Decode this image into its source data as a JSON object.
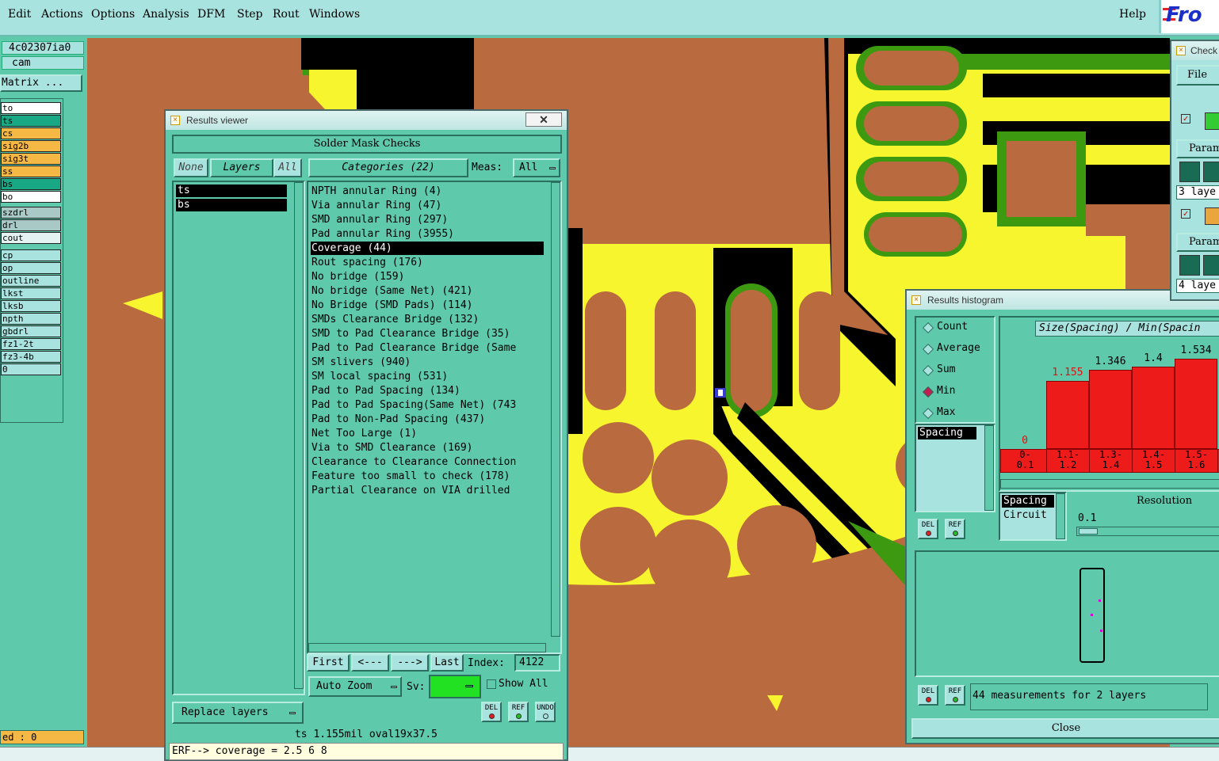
{
  "menubar": {
    "items": [
      "Edit",
      "Actions",
      "Options",
      "Analysis",
      "DFM",
      "Step",
      "Rout",
      "Windows"
    ],
    "help": "Help",
    "logo": "Fro"
  },
  "left_panel": {
    "job": "4c02307ia0",
    "step": "cam",
    "matrix_button": "Matrix ...",
    "layers": [
      "to",
      "ts",
      "cs",
      "sig2b",
      "sig3t",
      "ss",
      "bs",
      "bo",
      "szdrl",
      "drl",
      "cout",
      "cp",
      "op",
      "outline",
      "lkst",
      "lksb",
      "npth",
      "gbdrl",
      "fz1-2t",
      "fz3-4b",
      "0"
    ],
    "status": "ed : 0"
  },
  "results_viewer": {
    "title": "Results viewer",
    "close": "✕",
    "header": "Solder Mask Checks",
    "none_btn": "None",
    "layers_btn": "Layers",
    "all_btn": "All",
    "layers": [
      "ts",
      "bs"
    ],
    "categories_btn": "Categories (22)",
    "meas_label": "Meas:",
    "meas_value": "All",
    "categories": [
      "NPTH annular Ring (4)",
      "Via annular Ring (47)",
      "SMD annular Ring (297)",
      "Pad annular Ring (3955)",
      "Coverage (44)",
      "Rout spacing (176)",
      "No bridge (159)",
      "No bridge (Same Net) (421)",
      "No Bridge (SMD Pads) (114)",
      "SMDs Clearance Bridge (132)",
      "SMD to Pad Clearance Bridge (35)",
      "Pad to Pad Clearance Bridge (Same",
      "SM slivers (940)",
      "SM local spacing (531)",
      "Pad to Pad Spacing (134)",
      "Pad to Pad Spacing(Same Net) (743",
      "Pad to Non-Pad Spacing (437)",
      "Net Too Large (1)",
      "Via to SMD Clearance (169)",
      "Clearance to Clearance Connection",
      "Feature too small to check (178)",
      "Partial Clearance on VIA drilled"
    ],
    "selected_category": "Coverage (44)",
    "first_btn": "First",
    "prev_btn": "<---",
    "next_btn": "--->",
    "last_btn": "Last",
    "index_label": "Index:",
    "index_value": "4122",
    "auto_zoom_btn": "Auto Zoom",
    "sv_label": "Sv:",
    "show_all_label": "Show All",
    "replace_layers_btn": "Replace layers",
    "del_label": "DEL",
    "ref_label": "REF",
    "undo_label": "UNDO",
    "status_line": "ts 1.155mil  oval19x37.5",
    "erf_line": "ERF--> coverage = 2.5 6 8"
  },
  "histogram": {
    "title": "Results histogram",
    "stats": [
      "Count",
      "Average",
      "Sum",
      "Min",
      "Max"
    ],
    "selected_stat": "Min",
    "measure_list": [
      "Spacing"
    ],
    "graph_title": "Size(Spacing) / Min(Spacin",
    "lower_list": [
      "Spacing",
      "Circuit"
    ],
    "resolution_label": "Resolution",
    "resolution_value": "0.1",
    "del_label": "DEL",
    "ref_label": "REF",
    "measurements": "44 measurements for 2 layers",
    "close": "Close"
  },
  "chart_data": {
    "type": "bar",
    "categories": [
      "0-0.1",
      "1.1-1.2",
      "1.3-1.4",
      "1.4-1.5",
      "1.5-1.6"
    ],
    "values": [
      0,
      1.155,
      1.346,
      1.4,
      1.534
    ],
    "value_labels": [
      "0",
      "1.155",
      "1.346",
      "1.4",
      "1.534"
    ],
    "bin_labels_top": [
      "0-",
      "1.1-",
      "1.3-",
      "1.4-",
      "1.5-"
    ],
    "bin_labels_bottom": [
      "0.1",
      "1.2",
      "1.4",
      "1.5",
      "1.6"
    ],
    "title": "Size(Spacing) / Min(Spacin",
    "ylim": [
      0,
      1.7
    ]
  },
  "check_panel": {
    "title": "Check",
    "file_menu": "File",
    "param1": "Param",
    "layers1": "3 laye",
    "param2": "Param",
    "layers2": "4 laye"
  },
  "colors": {
    "app_bg": "#5fc9ab",
    "menubar_bg": "#a9e3df",
    "board_copper": "#b96a3e",
    "board_mask": "#f7f52d",
    "board_black": "#000000",
    "board_green": "#3d9a10",
    "histogram_bar": "#ee1b1b",
    "sv_color": "#22e022"
  }
}
